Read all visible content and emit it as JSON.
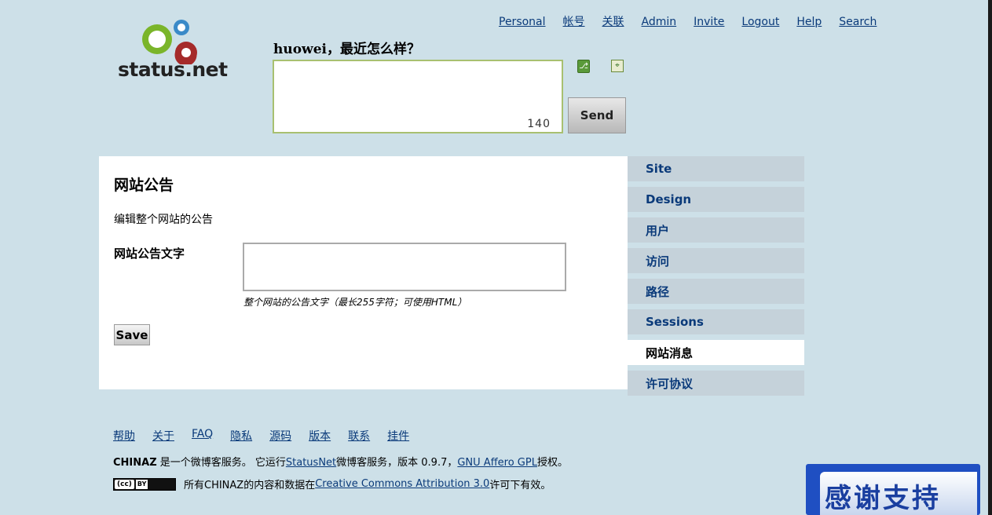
{
  "topnav": [
    "Personal",
    "帐号",
    "关联",
    "Admin",
    "Invite",
    "Logout",
    "Help",
    "Search"
  ],
  "logo": {
    "text": "status.net"
  },
  "notice": {
    "greeting": "huowei，最近怎么样？",
    "counter": "140",
    "send_label": "Send"
  },
  "content": {
    "title": "网站公告",
    "instructions": "编辑整个网站的公告",
    "field_label": "网站公告文字",
    "field_hint": "整个网站的公告文字（最长255字符；可使用HTML）",
    "save_label": "Save"
  },
  "sidenav": [
    {
      "label": "Site",
      "active": false
    },
    {
      "label": "Design",
      "active": false
    },
    {
      "label": "用户",
      "active": false
    },
    {
      "label": "访问",
      "active": false
    },
    {
      "label": "路径",
      "active": false
    },
    {
      "label": "Sessions",
      "active": false
    },
    {
      "label": "网站消息",
      "active": true
    },
    {
      "label": "许可协议",
      "active": false
    }
  ],
  "footer": {
    "links": [
      "帮助",
      "关于",
      "FAQ",
      "隐私",
      "源码",
      "版本",
      "联系",
      "挂件"
    ],
    "about": {
      "site": "CHINAZ",
      "pre": " 是一个微博客服务。 它运行",
      "statusnet": "StatusNet",
      "mid": "微博客服务，版本 0.9.7，",
      "gpl": "GNU Affero GPL",
      "post": "授权。"
    },
    "license": {
      "pre": "所有CHINAZ的内容和数据在",
      "link": "Creative Commons Attribution 3.0",
      "post": "许可下有效。",
      "badge_cc": "(cc)",
      "badge_by": "BY"
    }
  },
  "banner": {
    "text": "感谢支持"
  },
  "colors": {
    "background": "#cde0e8",
    "link": "#0a3a7a",
    "banner": "#1f4fc2"
  }
}
